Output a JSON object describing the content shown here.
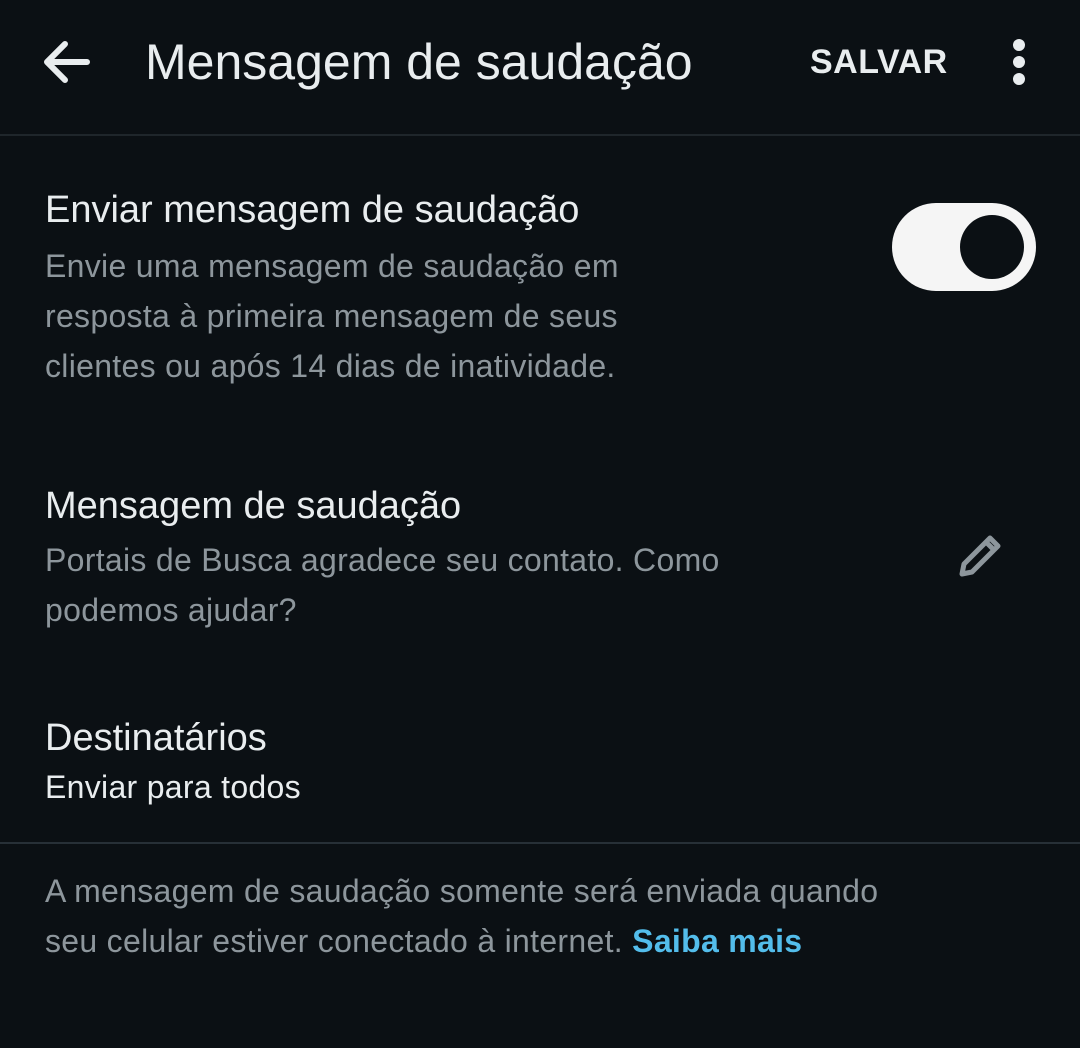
{
  "appbar": {
    "title": "Mensagem de saudação",
    "save_label": "SALVAR",
    "back_icon": "arrow-left-icon",
    "more_icon": "more-vertical-icon"
  },
  "send_greeting": {
    "title": "Enviar mensagem de saudação",
    "lines": [
      "Envie uma mensagem de saudação em",
      "resposta à primeira mensagem de seus",
      "clientes ou após 14 dias de inatividade."
    ],
    "toggle_on": true
  },
  "greeting_message": {
    "title": "Mensagem de saudação",
    "lines": [
      "Portais de Busca agradece seu contato. Como",
      "podemos ajudar?"
    ],
    "edit_icon": "pencil-icon"
  },
  "recipients": {
    "title": "Destinatários",
    "value": "Enviar para todos"
  },
  "footer": {
    "line1": "A mensagem de saudação somente será enviada quando",
    "line2": "seu celular estiver conectado à internet.",
    "link": "Saiba mais"
  },
  "colors": {
    "background": "#0b1014",
    "primary_text": "#e9edef",
    "secondary_text": "#8d969c",
    "link": "#53bdeb"
  }
}
